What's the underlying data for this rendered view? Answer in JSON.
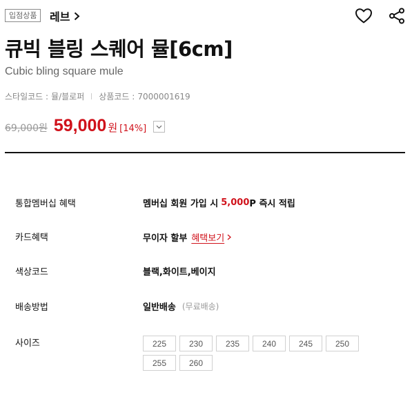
{
  "header": {
    "badge": "입점상품",
    "brand": "레브",
    "wishlist_icon": "heart-icon",
    "share_icon": "share-icon"
  },
  "product": {
    "title": "큐빅 블링 스퀘어 뮬[6cm]",
    "subtitle": "Cubic bling square mule",
    "style_code_label": "스타일코드 :",
    "style_code_value": "뮬/블로퍼",
    "product_code_label": "상품코드 :",
    "product_code_value": "7000001619"
  },
  "price": {
    "original": "69,000원",
    "sale": "59,000",
    "currency": "원",
    "discount": "[14%]"
  },
  "info": {
    "membership_label": "통합멤버십 혜택",
    "membership_pre": "멤버십 회원 가입 시",
    "membership_points": "5,000",
    "membership_post": "P 즉시 적립",
    "card_label": "카드혜택",
    "card_value": "무이자 할부",
    "card_link": "혜택보기",
    "color_label": "색상코드",
    "color_value": "블랙,화이트,베이지",
    "shipping_label": "배송방법",
    "shipping_value": "일반배송",
    "shipping_note": "(무료배송)",
    "size_label": "사이즈"
  },
  "sizes": [
    "225",
    "230",
    "235",
    "240",
    "245",
    "250",
    "255",
    "260"
  ],
  "colors": {
    "accent_red": "#d0121b",
    "text_dark": "#111111",
    "text_muted": "#888888"
  }
}
